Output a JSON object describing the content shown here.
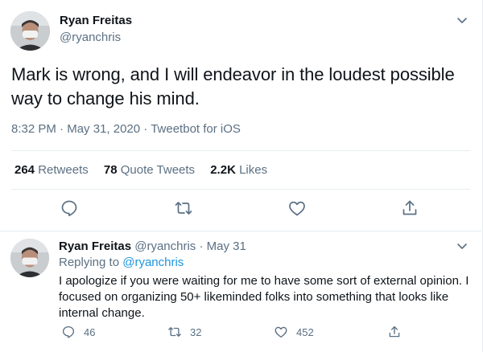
{
  "main_tweet": {
    "author_name": "Ryan Freitas",
    "author_handle": "@ryanchris",
    "text": "Mark is wrong, and I will endeavor in the loudest possible way to change his mind.",
    "time": "8:32 PM",
    "date": "May 31, 2020",
    "client": "Tweetbot for iOS",
    "separator": "·",
    "stats": {
      "retweets_count": "264",
      "retweets_label": "Retweets",
      "quote_count": "78",
      "quote_label": "Quote Tweets",
      "likes_count": "2.2K",
      "likes_label": "Likes"
    },
    "icons": [
      "chevron-down-icon",
      "reply-icon",
      "retweet-icon",
      "like-icon",
      "share-icon"
    ]
  },
  "reply_tweet": {
    "author_name": "Ryan Freitas",
    "author_handle": "@ryanchris",
    "separator": "·",
    "date": "May 31",
    "replying_label": "Replying to",
    "replying_to": "@ryanchris",
    "text": "I apologize if you were waiting for me to have some sort of external opinion. I focused on organizing 50+ likeminded folks into something that looks like internal change.",
    "reply_count": "46",
    "retweet_count": "32",
    "like_count": "452"
  },
  "colors": {
    "text_primary": "#0f1419",
    "text_secondary": "#5b7083",
    "link": "#1b95e0",
    "divider": "#e6ecf0"
  }
}
